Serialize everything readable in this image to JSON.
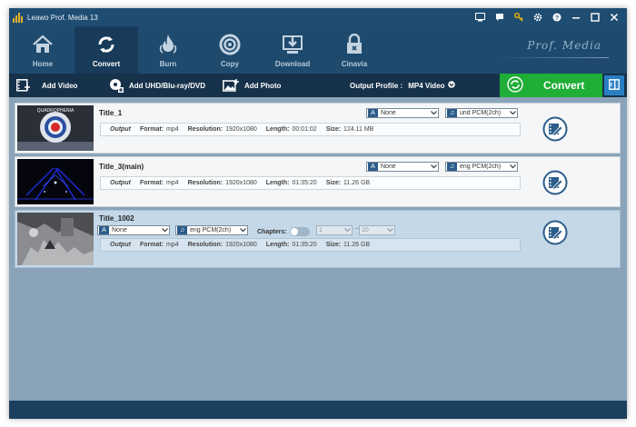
{
  "window": {
    "title": "Leawo Prof. Media 13"
  },
  "nav": {
    "items": [
      {
        "label": "Home",
        "active": false
      },
      {
        "label": "Convert",
        "active": true
      },
      {
        "label": "Burn",
        "active": false
      },
      {
        "label": "Copy",
        "active": false
      },
      {
        "label": "Download",
        "active": false
      },
      {
        "label": "Cinavia",
        "active": false
      }
    ],
    "brand": "Prof. Media"
  },
  "toolbar": {
    "add_video": "Add Video",
    "add_uhd": "Add UHD/Blu-ray/DVD",
    "add_photo": "Add Photo",
    "output_profile_label": "Output Profile :",
    "output_profile_value": "MP4 Video",
    "convert_label": "Convert"
  },
  "colors": {
    "titlebar": "#1f4d72",
    "navbar": "#1e4a6e",
    "toolbar": "#16324a",
    "convert_green": "#1fae36",
    "content_bg": "#8aa3b8",
    "accent_blue": "#2a7fc4"
  },
  "labels": {
    "output": "Output",
    "format": "Format:",
    "resolution": "Resolution:",
    "length": "Length:",
    "size": "Size:",
    "chapters": "Chapters:",
    "range_sep": "~"
  },
  "titles": [
    {
      "name": "Title_1",
      "subtitle": "None",
      "audio": "und PCM(2ch)",
      "format": "mp4",
      "resolution": "1920x1080",
      "length": "00:01:02",
      "size": "124.11 MB",
      "thumb_text": "QUADROPHENIA"
    },
    {
      "name": "Title_3(main)",
      "subtitle": "None",
      "audio": "eng PCM(2ch)",
      "format": "mp4",
      "resolution": "1920x1080",
      "length": "01:35:20",
      "size": "11.26 GB"
    },
    {
      "name": "Title_1002",
      "subtitle": "None",
      "audio": "eng PCM(2ch)",
      "chapter_from": "1",
      "chapter_to": "10",
      "format": "mp4",
      "resolution": "1920x1080",
      "length": "01:35:20",
      "size": "11.26 GB"
    }
  ]
}
